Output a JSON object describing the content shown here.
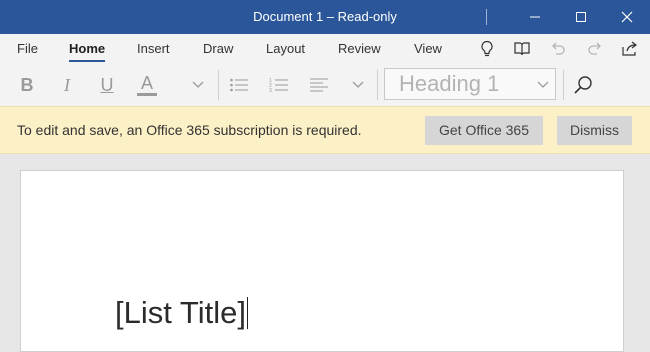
{
  "window": {
    "title": "Document 1 – Read-only"
  },
  "ribbon": {
    "tabs": [
      {
        "label": "File"
      },
      {
        "label": "Home",
        "active": true
      },
      {
        "label": "Insert"
      },
      {
        "label": "Draw"
      },
      {
        "label": "Layout"
      },
      {
        "label": "Review"
      },
      {
        "label": "View"
      }
    ],
    "right_icons": [
      "lightbulb-icon",
      "reading-view-icon",
      "undo-icon",
      "redo-icon",
      "share-icon"
    ],
    "tools": {
      "bold_label": "B",
      "italic_label": "I",
      "underline_label": "U",
      "font_color_label": "A",
      "style_value": "Heading 1"
    }
  },
  "message_bar": {
    "text": "To edit and save, an Office 365 subscription is required.",
    "get_office_label": "Get Office 365",
    "dismiss_label": "Dismiss"
  },
  "document": {
    "list_title": "[List Title]"
  },
  "colors": {
    "titlebar": "#2b579a",
    "message_bar": "#fcf0c6",
    "accent": "#2b579a"
  }
}
